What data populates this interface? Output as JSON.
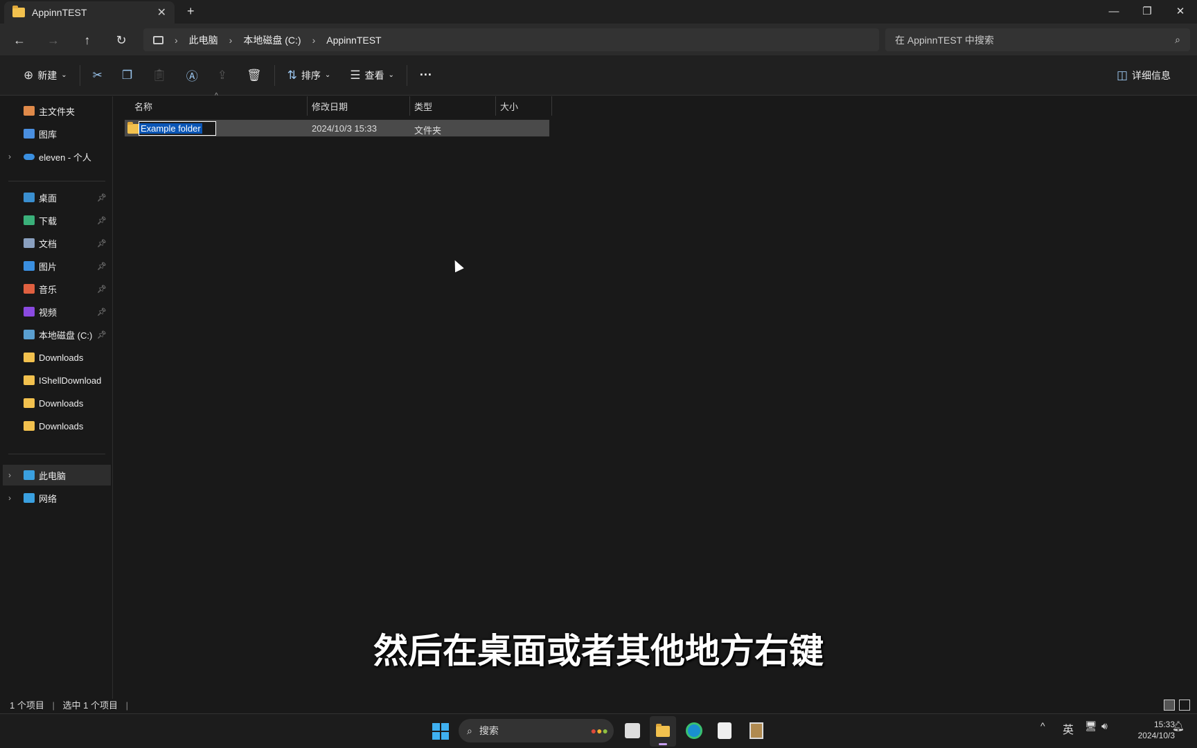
{
  "window": {
    "tab_title": "AppinnTEST",
    "new_tab": "+",
    "close_tab": "✕",
    "minimize": "—",
    "restore": "❐",
    "close": "✕"
  },
  "nav": {
    "back": "←",
    "forward": "→",
    "up": "↑",
    "refresh": "↻",
    "breadcrumb": [
      "此电脑",
      "本地磁盘 (C:)",
      "AppinnTEST"
    ],
    "search_placeholder": "在 AppinnTEST 中搜索"
  },
  "toolbar": {
    "new_label": "新建",
    "sort_label": "排序",
    "view_label": "查看",
    "more": "···",
    "details_label": "详细信息"
  },
  "sidebar": {
    "top": [
      {
        "label": "主文件夹",
        "color": "#e08a4a"
      },
      {
        "label": "图库",
        "color": "#4a8fe0"
      },
      {
        "label": "eleven - 个人",
        "color": "#3a8fe0"
      }
    ],
    "pinned": [
      {
        "label": "桌面",
        "color": "#3a8fd0"
      },
      {
        "label": "下载",
        "color": "#3ab07a"
      },
      {
        "label": "文档",
        "color": "#8aa0c0"
      },
      {
        "label": "图片",
        "color": "#3a8fe0"
      },
      {
        "label": "音乐",
        "color": "#e06040"
      },
      {
        "label": "视频",
        "color": "#8a4ae0"
      },
      {
        "label": "本地磁盘 (C:)",
        "color": "#5a9fd0"
      },
      {
        "label": "Downloads",
        "color": "#f2c14e"
      },
      {
        "label": "IShellDownload",
        "color": "#f2c14e"
      },
      {
        "label": "Downloads",
        "color": "#f2c14e"
      },
      {
        "label": "Downloads",
        "color": "#f2c14e"
      }
    ],
    "bottom": [
      {
        "label": "此电脑",
        "color": "#3aa0e0"
      },
      {
        "label": "网络",
        "color": "#3aa0e0"
      }
    ]
  },
  "columns": {
    "name": "名称",
    "modified": "修改日期",
    "type": "类型",
    "size": "大小"
  },
  "files": [
    {
      "name": "Example folder",
      "modified": "2024/10/3 15:33",
      "type": "文件夹",
      "size": ""
    }
  ],
  "subtitle": "然后在桌面或者其他地方右键",
  "status": {
    "count": "1 个项目",
    "selected": "选中 1 个项目"
  },
  "taskbar": {
    "search_label": "搜索",
    "ime": "英",
    "time": "15:33",
    "date": "2024/10/3"
  }
}
